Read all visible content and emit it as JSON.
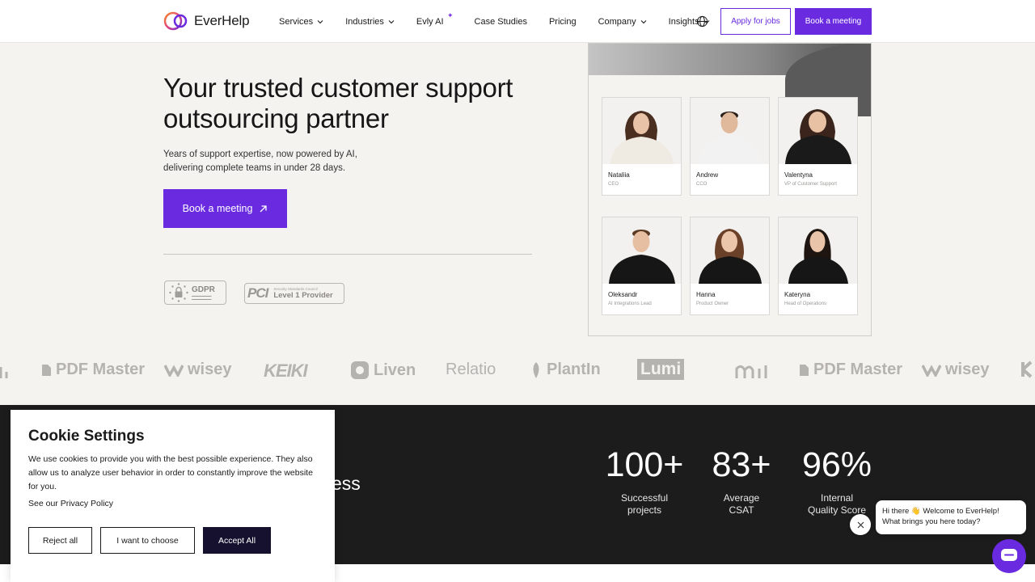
{
  "nav": {
    "logo_text": "EverHelp",
    "links": [
      {
        "label": "Services",
        "dropdown": true
      },
      {
        "label": "Industries",
        "dropdown": true
      },
      {
        "label": "Evly AI",
        "dropdown": false
      },
      {
        "label": "Case Studies",
        "dropdown": false
      },
      {
        "label": "Pricing",
        "dropdown": false
      },
      {
        "label": "Company",
        "dropdown": true
      },
      {
        "label": "Insights",
        "dropdown": true
      }
    ],
    "apply_label": "Apply for jobs",
    "book_label": "Book a meeting"
  },
  "hero": {
    "title": "Your trusted customer support outsourcing partner",
    "subtitle_line1": "Years of support expertise, now powered by AI,",
    "subtitle_line2": "delivering complete teams in under 28 days.",
    "cta_label": "Book a meeting",
    "gdpr_title": "GDPR",
    "pci_mark": "PCI",
    "pci_small": "Security Standards Council",
    "pci_big": "Level 1 Provider"
  },
  "team": [
    {
      "name": "Nataliia",
      "role": "CEO"
    },
    {
      "name": "Andrew",
      "role": "CCO"
    },
    {
      "name": "Valentyna",
      "role": "VP of Customer Support"
    },
    {
      "name": "Oleksandr",
      "role": "AI Integrations Lead"
    },
    {
      "name": "Hanna",
      "role": "Product Owner"
    },
    {
      "name": "Kateryna",
      "role": "Head of Operations"
    }
  ],
  "client_logos": [
    "PDF Master",
    "wisey",
    "KEIKI",
    "Liven",
    "Relatio",
    "PlantIn",
    "Lumi",
    "PDF Master",
    "wisey"
  ],
  "stats": {
    "partial_heading": "ess",
    "items": [
      {
        "value": "100+",
        "label_line1": "Successful",
        "label_line2": "projects"
      },
      {
        "value": "83+",
        "label_line1": "Average",
        "label_line2": "CSAT"
      },
      {
        "value": "96%",
        "label_line1": "Internal",
        "label_line2": "Quality Score"
      }
    ]
  },
  "cookie": {
    "title": "Cookie Settings",
    "body": "We use cookies to provide you with the best possible experience. They also allow us to analyze user behavior in order to constantly improve the website for you.",
    "policy_link": "See our Privacy Policy",
    "reject_label": "Reject all",
    "choose_label": "I want to choose",
    "accept_label": "Accept All"
  },
  "chat": {
    "greeting_line1": "Hi there 👋 Welcome to EverHelp!",
    "greeting_line2": "What brings you here today?"
  },
  "colors": {
    "brand_purple": "#6a2be0",
    "dark_bg": "#1c1c1c",
    "page_bg": "#f5f3f0",
    "accept_bg": "#16112e"
  }
}
